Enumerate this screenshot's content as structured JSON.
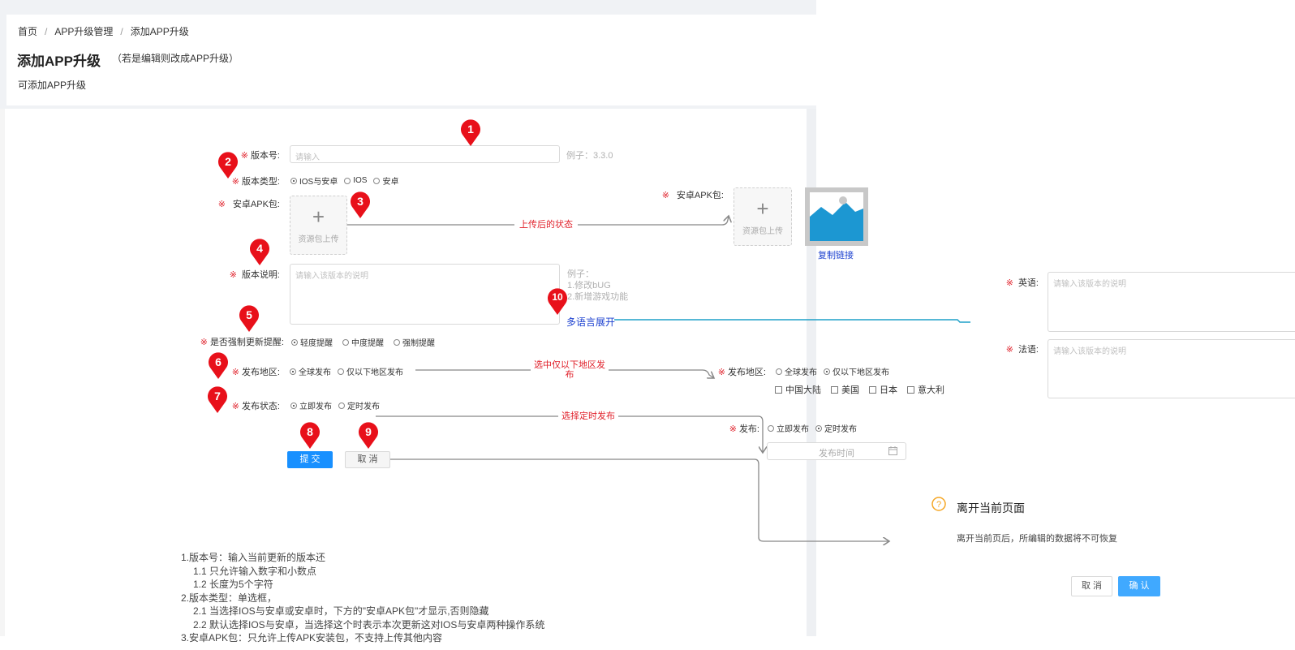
{
  "breadcrumb": {
    "home": "首页",
    "sep": "/",
    "section": "APP升级管理",
    "current": "添加APP升级"
  },
  "page": {
    "title": "添加APP升级",
    "subtitle": "（若是编辑则改成APP升级）",
    "description": "可添加APP升级"
  },
  "form": {
    "version_label": "版本号:",
    "version_placeholder": "请输入",
    "version_hint": "例子：3.3.0",
    "type_label": "版本类型:",
    "type_options": [
      "IOS与安卓",
      "IOS",
      "安卓"
    ],
    "apk_label": "安卓APK包:",
    "upload_text": "资源包上传",
    "desc_label": "版本说明:",
    "desc_placeholder": "请输入该版本的说明",
    "desc_hint": [
      "例子：",
      "1.修改bUG",
      "2.新增游戏功能"
    ],
    "multilang_link": "多语言展开",
    "force_label": "是否强制更新提醒:",
    "force_options": [
      "轻度提醒",
      "中度提醒",
      "强制提醒"
    ],
    "region_label": "发布地区:",
    "region_options": [
      "全球发布",
      "仅以下地区发布"
    ],
    "status_label": "发布状态:",
    "status_options": [
      "立即发布",
      "定时发布"
    ],
    "submit": "提 交",
    "cancel": "取 消"
  },
  "uploaded": {
    "apk_label": "安卓APK包:",
    "upload_text": "资源包上传",
    "copy_link": "复制链接"
  },
  "annotations": {
    "after_upload": "上传后的状态",
    "region_selected": "选中仅以下地区发布",
    "timed_publish": "选择定时发布"
  },
  "region_expanded": {
    "label": "发布地区:",
    "options": [
      "全球发布",
      "仅以下地区发布"
    ],
    "countries": [
      "中国大陆",
      "美国",
      "日本",
      "意大利"
    ]
  },
  "timed_expanded": {
    "label": "发布:",
    "options": [
      "立即发布",
      "定时发布"
    ],
    "time_placeholder": "发布时间"
  },
  "languages": {
    "english_label": "英语:",
    "french_label": "法语:",
    "placeholder": "请输入该版本的说明"
  },
  "leave_dialog": {
    "title": "离开当前页面",
    "message": "离开当前页后，所编辑的数据将不可恢复",
    "cancel": "取 消",
    "confirm": "确 认"
  },
  "markers": [
    "1",
    "2",
    "3",
    "4",
    "5",
    "6",
    "7",
    "8",
    "9",
    "10"
  ],
  "notes": [
    "1.版本号：输入当前更新的版本还",
    "1.1 只允许输入数字和小数点",
    "1.2 长度为5个字符",
    "2.版本类型：单选框，",
    "2.1 当选择IOS与安卓或安卓时，下方的\"安卓APK包\"才显示,否则隐藏",
    "2.2 默认选择IOS与安卓，当选择这个时表示本次更新这对IOS与安卓两种操作系统",
    "3.安卓APK包：只允许上传APK安装包，不支持上传其他内容"
  ],
  "colors": {
    "primary": "#1890ff",
    "required": "#e0202a",
    "marker": "#e8101a",
    "link": "#1a3fcf",
    "connector": "#888888",
    "teal_line": "#1fa0c8",
    "warning": "#f5a623"
  }
}
